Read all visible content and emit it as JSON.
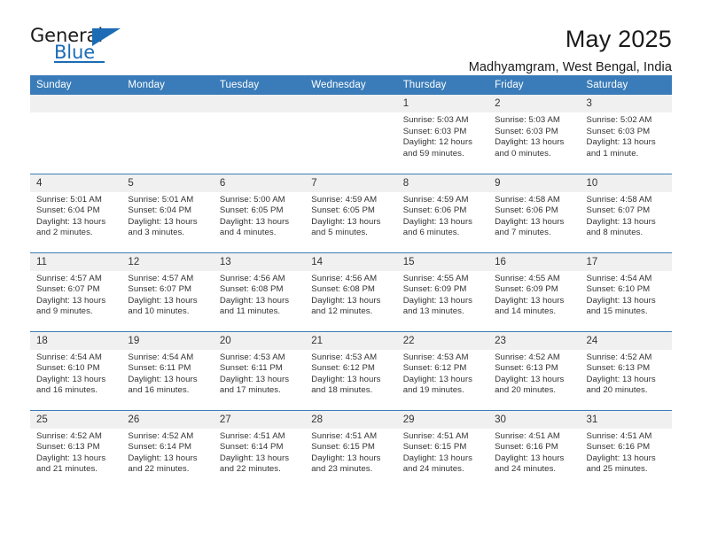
{
  "brand": {
    "name_top": "General",
    "name_bottom": "Blue",
    "accent_color": "#1b6cb5"
  },
  "header": {
    "title": "May 2025",
    "location": "Madhyamgram, West Bengal, India"
  },
  "calendar": {
    "header_bg": "#3a7cb9",
    "daynum_bg": "#f0f0f0",
    "weekday_headers": [
      "Sunday",
      "Monday",
      "Tuesday",
      "Wednesday",
      "Thursday",
      "Friday",
      "Saturday"
    ],
    "weeks": [
      [
        {
          "day": "",
          "empty": true
        },
        {
          "day": "",
          "empty": true
        },
        {
          "day": "",
          "empty": true
        },
        {
          "day": "",
          "empty": true
        },
        {
          "day": "1",
          "sunrise": "Sunrise: 5:03 AM",
          "sunset": "Sunset: 6:03 PM",
          "daylight_1": "Daylight: 12 hours",
          "daylight_2": "and 59 minutes."
        },
        {
          "day": "2",
          "sunrise": "Sunrise: 5:03 AM",
          "sunset": "Sunset: 6:03 PM",
          "daylight_1": "Daylight: 13 hours",
          "daylight_2": "and 0 minutes."
        },
        {
          "day": "3",
          "sunrise": "Sunrise: 5:02 AM",
          "sunset": "Sunset: 6:03 PM",
          "daylight_1": "Daylight: 13 hours",
          "daylight_2": "and 1 minute."
        }
      ],
      [
        {
          "day": "4",
          "sunrise": "Sunrise: 5:01 AM",
          "sunset": "Sunset: 6:04 PM",
          "daylight_1": "Daylight: 13 hours",
          "daylight_2": "and 2 minutes."
        },
        {
          "day": "5",
          "sunrise": "Sunrise: 5:01 AM",
          "sunset": "Sunset: 6:04 PM",
          "daylight_1": "Daylight: 13 hours",
          "daylight_2": "and 3 minutes."
        },
        {
          "day": "6",
          "sunrise": "Sunrise: 5:00 AM",
          "sunset": "Sunset: 6:05 PM",
          "daylight_1": "Daylight: 13 hours",
          "daylight_2": "and 4 minutes."
        },
        {
          "day": "7",
          "sunrise": "Sunrise: 4:59 AM",
          "sunset": "Sunset: 6:05 PM",
          "daylight_1": "Daylight: 13 hours",
          "daylight_2": "and 5 minutes."
        },
        {
          "day": "8",
          "sunrise": "Sunrise: 4:59 AM",
          "sunset": "Sunset: 6:06 PM",
          "daylight_1": "Daylight: 13 hours",
          "daylight_2": "and 6 minutes."
        },
        {
          "day": "9",
          "sunrise": "Sunrise: 4:58 AM",
          "sunset": "Sunset: 6:06 PM",
          "daylight_1": "Daylight: 13 hours",
          "daylight_2": "and 7 minutes."
        },
        {
          "day": "10",
          "sunrise": "Sunrise: 4:58 AM",
          "sunset": "Sunset: 6:07 PM",
          "daylight_1": "Daylight: 13 hours",
          "daylight_2": "and 8 minutes."
        }
      ],
      [
        {
          "day": "11",
          "sunrise": "Sunrise: 4:57 AM",
          "sunset": "Sunset: 6:07 PM",
          "daylight_1": "Daylight: 13 hours",
          "daylight_2": "and 9 minutes."
        },
        {
          "day": "12",
          "sunrise": "Sunrise: 4:57 AM",
          "sunset": "Sunset: 6:07 PM",
          "daylight_1": "Daylight: 13 hours",
          "daylight_2": "and 10 minutes."
        },
        {
          "day": "13",
          "sunrise": "Sunrise: 4:56 AM",
          "sunset": "Sunset: 6:08 PM",
          "daylight_1": "Daylight: 13 hours",
          "daylight_2": "and 11 minutes."
        },
        {
          "day": "14",
          "sunrise": "Sunrise: 4:56 AM",
          "sunset": "Sunset: 6:08 PM",
          "daylight_1": "Daylight: 13 hours",
          "daylight_2": "and 12 minutes."
        },
        {
          "day": "15",
          "sunrise": "Sunrise: 4:55 AM",
          "sunset": "Sunset: 6:09 PM",
          "daylight_1": "Daylight: 13 hours",
          "daylight_2": "and 13 minutes."
        },
        {
          "day": "16",
          "sunrise": "Sunrise: 4:55 AM",
          "sunset": "Sunset: 6:09 PM",
          "daylight_1": "Daylight: 13 hours",
          "daylight_2": "and 14 minutes."
        },
        {
          "day": "17",
          "sunrise": "Sunrise: 4:54 AM",
          "sunset": "Sunset: 6:10 PM",
          "daylight_1": "Daylight: 13 hours",
          "daylight_2": "and 15 minutes."
        }
      ],
      [
        {
          "day": "18",
          "sunrise": "Sunrise: 4:54 AM",
          "sunset": "Sunset: 6:10 PM",
          "daylight_1": "Daylight: 13 hours",
          "daylight_2": "and 16 minutes."
        },
        {
          "day": "19",
          "sunrise": "Sunrise: 4:54 AM",
          "sunset": "Sunset: 6:11 PM",
          "daylight_1": "Daylight: 13 hours",
          "daylight_2": "and 16 minutes."
        },
        {
          "day": "20",
          "sunrise": "Sunrise: 4:53 AM",
          "sunset": "Sunset: 6:11 PM",
          "daylight_1": "Daylight: 13 hours",
          "daylight_2": "and 17 minutes."
        },
        {
          "day": "21",
          "sunrise": "Sunrise: 4:53 AM",
          "sunset": "Sunset: 6:12 PM",
          "daylight_1": "Daylight: 13 hours",
          "daylight_2": "and 18 minutes."
        },
        {
          "day": "22",
          "sunrise": "Sunrise: 4:53 AM",
          "sunset": "Sunset: 6:12 PM",
          "daylight_1": "Daylight: 13 hours",
          "daylight_2": "and 19 minutes."
        },
        {
          "day": "23",
          "sunrise": "Sunrise: 4:52 AM",
          "sunset": "Sunset: 6:13 PM",
          "daylight_1": "Daylight: 13 hours",
          "daylight_2": "and 20 minutes."
        },
        {
          "day": "24",
          "sunrise": "Sunrise: 4:52 AM",
          "sunset": "Sunset: 6:13 PM",
          "daylight_1": "Daylight: 13 hours",
          "daylight_2": "and 20 minutes."
        }
      ],
      [
        {
          "day": "25",
          "sunrise": "Sunrise: 4:52 AM",
          "sunset": "Sunset: 6:13 PM",
          "daylight_1": "Daylight: 13 hours",
          "daylight_2": "and 21 minutes."
        },
        {
          "day": "26",
          "sunrise": "Sunrise: 4:52 AM",
          "sunset": "Sunset: 6:14 PM",
          "daylight_1": "Daylight: 13 hours",
          "daylight_2": "and 22 minutes."
        },
        {
          "day": "27",
          "sunrise": "Sunrise: 4:51 AM",
          "sunset": "Sunset: 6:14 PM",
          "daylight_1": "Daylight: 13 hours",
          "daylight_2": "and 22 minutes."
        },
        {
          "day": "28",
          "sunrise": "Sunrise: 4:51 AM",
          "sunset": "Sunset: 6:15 PM",
          "daylight_1": "Daylight: 13 hours",
          "daylight_2": "and 23 minutes."
        },
        {
          "day": "29",
          "sunrise": "Sunrise: 4:51 AM",
          "sunset": "Sunset: 6:15 PM",
          "daylight_1": "Daylight: 13 hours",
          "daylight_2": "and 24 minutes."
        },
        {
          "day": "30",
          "sunrise": "Sunrise: 4:51 AM",
          "sunset": "Sunset: 6:16 PM",
          "daylight_1": "Daylight: 13 hours",
          "daylight_2": "and 24 minutes."
        },
        {
          "day": "31",
          "sunrise": "Sunrise: 4:51 AM",
          "sunset": "Sunset: 6:16 PM",
          "daylight_1": "Daylight: 13 hours",
          "daylight_2": "and 25 minutes."
        }
      ]
    ]
  }
}
